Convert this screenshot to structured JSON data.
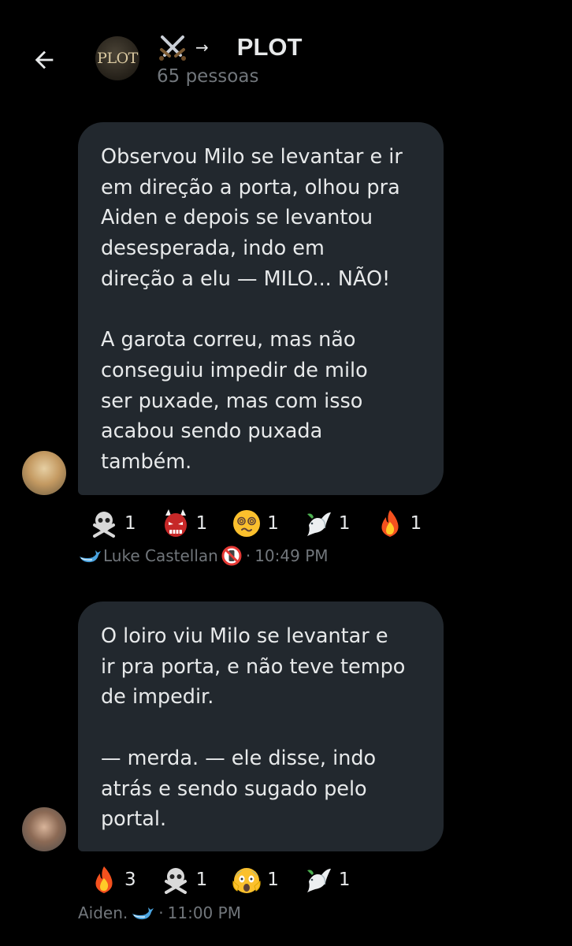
{
  "header": {
    "back_icon": "arrow-left-icon",
    "avatar_text": "PLOT",
    "title_prefix_icon": "crossed-swords-icon",
    "title_arrow": "→",
    "title": "PLOT",
    "subtitle": "65 pessoas"
  },
  "messages": [
    {
      "text": "Observou Milo se levantar e ir\nem direção a porta, olhou pra\nAiden e depois se levantou\ndesesperada, indo em\ndireção a elu — MILO... NÃO!\n\nA garota correu, mas não\nconseguiu impedir de milo\nser puxade, mas com isso\nacabou sendo puxada\ntambém.",
      "reactions": [
        {
          "icon": "skull-crossbones-icon",
          "count": "1"
        },
        {
          "icon": "ogre-icon",
          "count": "1"
        },
        {
          "icon": "dizzy-face-icon",
          "count": "1"
        },
        {
          "icon": "dove-icon",
          "count": "1"
        },
        {
          "icon": "fire-icon",
          "count": "1"
        }
      ],
      "sender": "Luke Castellan",
      "sender_icons": [
        "whale-icon",
        "no-mobile-phones-icon"
      ],
      "time": "10:49 PM"
    },
    {
      "text": "O loiro viu Milo se levantar e\nir pra porta, e não teve tempo\nde impedir.\n\n— merda. — ele disse, indo\natrás e sendo sugado pelo\nportal.",
      "reactions": [
        {
          "icon": "fire-icon",
          "count": "3"
        },
        {
          "icon": "skull-crossbones-icon",
          "count": "1"
        },
        {
          "icon": "screaming-face-icon",
          "count": "1"
        },
        {
          "icon": "dove-icon",
          "count": "1"
        }
      ],
      "sender": "Aiden.",
      "sender_icons": [
        "whale-icon"
      ],
      "time": "11:00 PM"
    }
  ],
  "meta": {
    "separator": "·"
  },
  "colors": {
    "background": "#000000",
    "bubble": "#22282e",
    "text": "#e7e9ea",
    "muted": "#71767b"
  }
}
